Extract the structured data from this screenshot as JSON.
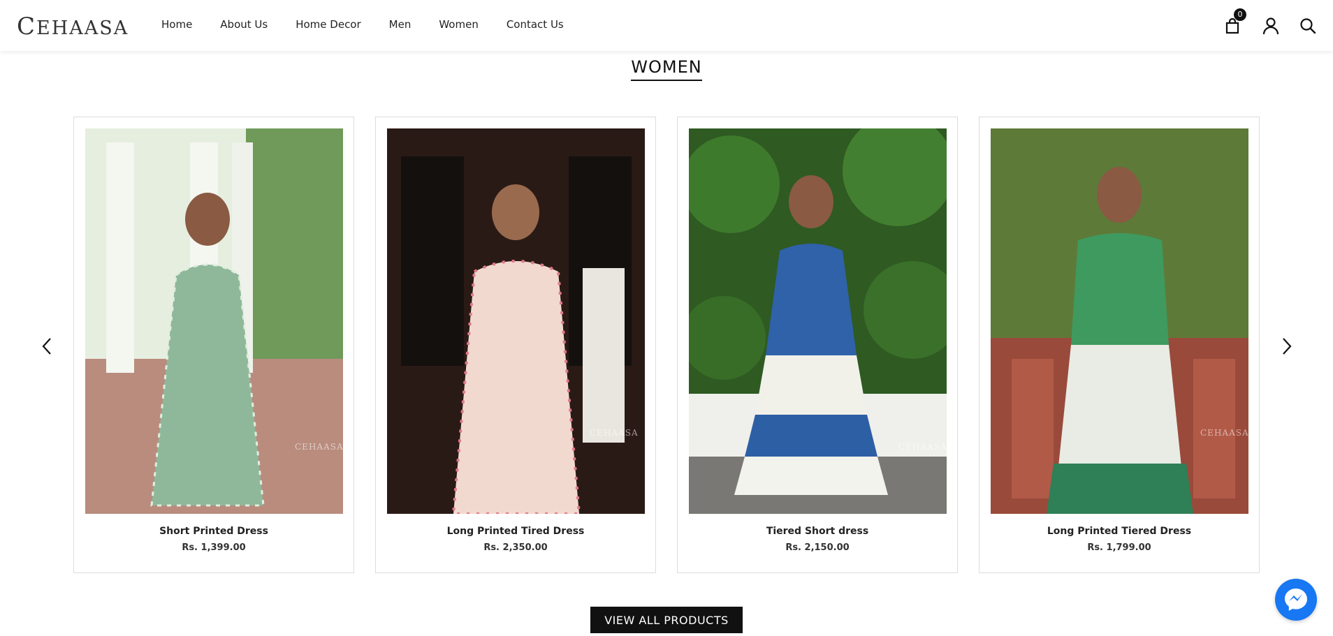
{
  "brand": {
    "logo_text": "EHAASA",
    "logo_initial": "C",
    "watermark": "CEHAASA"
  },
  "nav": {
    "items": [
      {
        "label": "Home"
      },
      {
        "label": "About Us"
      },
      {
        "label": "Home Decor"
      },
      {
        "label": "Men"
      },
      {
        "label": "Women"
      },
      {
        "label": "Contact Us"
      }
    ]
  },
  "header_icons": {
    "cart_icon": "shopping-bag-icon",
    "cart_count": "0",
    "account_icon": "user-icon",
    "search_icon": "search-icon"
  },
  "section": {
    "title": "WOMEN"
  },
  "products": [
    {
      "name": "Short Printed Dress",
      "price": "Rs. 1,399.00"
    },
    {
      "name": "Long Printed Tired Dress",
      "price": "Rs. 2,350.00"
    },
    {
      "name": "Tiered Short dress",
      "price": "Rs. 2,150.00"
    },
    {
      "name": "Long Printed Tiered Dress",
      "price": "Rs. 1,799.00"
    }
  ],
  "carousel": {
    "prev_icon": "chevron-left-icon",
    "next_icon": "chevron-right-icon"
  },
  "cta": {
    "view_all_label": "VIEW ALL PRODUCTS"
  },
  "chat": {
    "icon": "messenger-icon",
    "color": "#1877f2"
  },
  "colors": {
    "accent": "#111111",
    "border": "#dcdcdc",
    "background": "#ffffff"
  }
}
